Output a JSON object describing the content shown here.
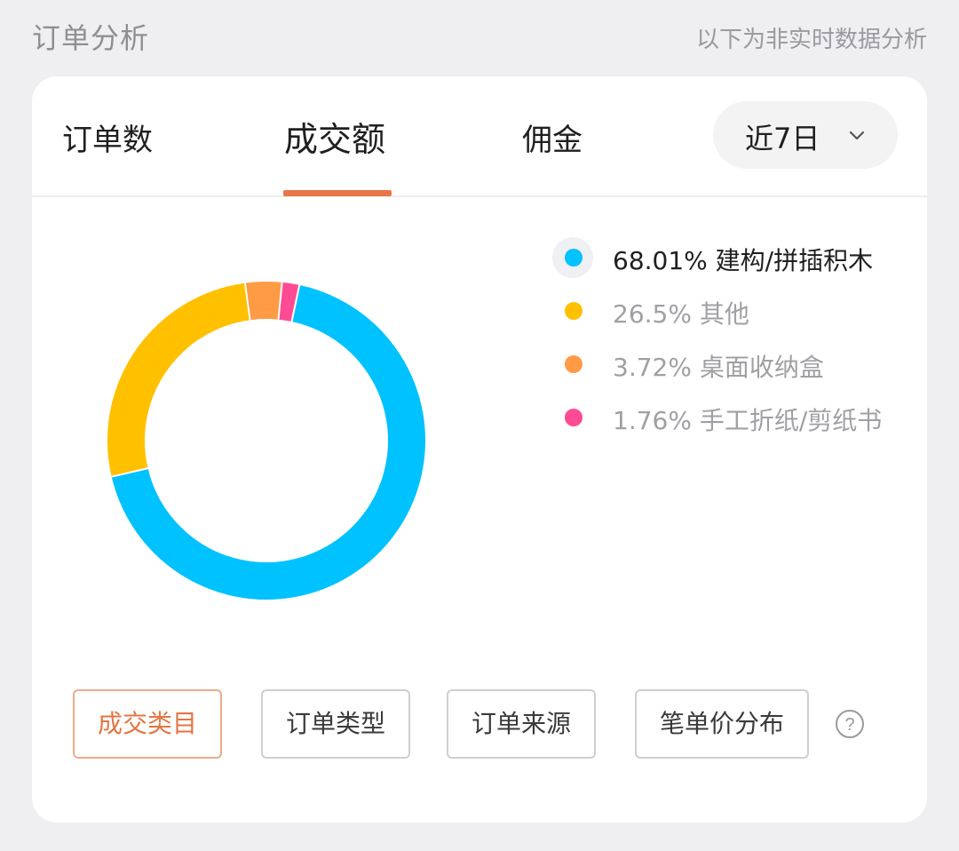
{
  "header": {
    "title": "订单分析",
    "note": "以下为非实时数据分析"
  },
  "tabs": [
    {
      "label": "订单数",
      "active": false
    },
    {
      "label": "成交额",
      "active": true
    },
    {
      "label": "佣金",
      "active": false
    }
  ],
  "range_select": {
    "value": "近7日",
    "icon": "chevron-down-icon"
  },
  "chart_data": {
    "type": "pie",
    "style": "donut",
    "slices": [
      {
        "label": "68.01% 建构/拼插积木",
        "name": "建构/拼插积木",
        "value": 68.01,
        "color": "#00c2ff"
      },
      {
        "label": "26.5% 其他",
        "name": "其他",
        "value": 26.5,
        "color": "#ffc000"
      },
      {
        "label": "3.72% 桌面收纳盒",
        "name": "桌面收纳盒",
        "value": 3.72,
        "color": "#ff9a45"
      },
      {
        "label": "1.76% 手工折纸/剪纸书",
        "name": "手工折纸/剪纸书",
        "value": 1.76,
        "color": "#ff4a94"
      }
    ],
    "legend_position": "right",
    "selected": 0
  },
  "dimension_buttons": [
    {
      "label": "成交类目",
      "active": true
    },
    {
      "label": "订单类型",
      "active": false
    },
    {
      "label": "订单来源",
      "active": false
    },
    {
      "label": "笔单价分布",
      "active": false
    }
  ],
  "help_icon": "question-circle-icon"
}
